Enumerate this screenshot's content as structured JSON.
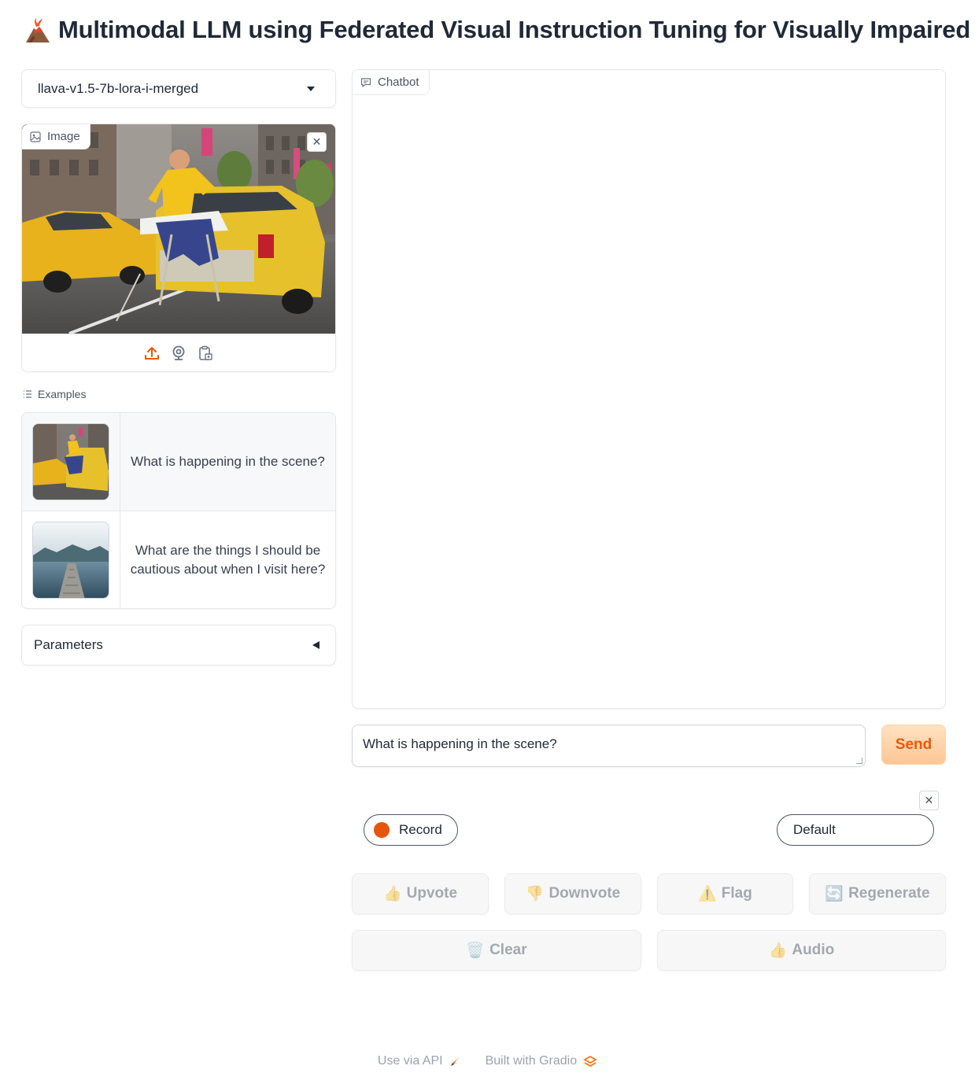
{
  "header": {
    "title": "Multimodal LLM using Federated Visual Instruction Tuning for Visually Impaired",
    "logo_icon": "volcano-icon"
  },
  "model_selector": {
    "selected": "llava-v1.5-7b-lora-i-merged"
  },
  "image_panel": {
    "label": "Image",
    "tools": [
      "upload-icon",
      "webcam-icon",
      "clipboard-icon"
    ]
  },
  "examples": {
    "label": "Examples",
    "items": [
      {
        "text": "What is happening in the scene?",
        "thumb": "taxi-ironing-photo"
      },
      {
        "text": "What are the things I should be cautious about when I visit here?",
        "thumb": "lake-pier-photo"
      }
    ]
  },
  "parameters": {
    "label": "Parameters"
  },
  "chatbot": {
    "label": "Chatbot"
  },
  "input": {
    "value": "What is happening in the scene?",
    "send_label": "Send"
  },
  "audio": {
    "record_label": "Record",
    "voice_selected": "Default"
  },
  "actions": {
    "upvote": "Upvote",
    "downvote": "Downvote",
    "flag": "Flag",
    "regenerate": "Regenerate",
    "clear": "Clear",
    "audio": "Audio"
  },
  "footer": {
    "api": "Use via API",
    "built": "Built with Gradio"
  },
  "colors": {
    "accent": "#ea580c",
    "send_bg": "#fec694",
    "record_dot": "#e4560b",
    "text": "#1f2937"
  }
}
